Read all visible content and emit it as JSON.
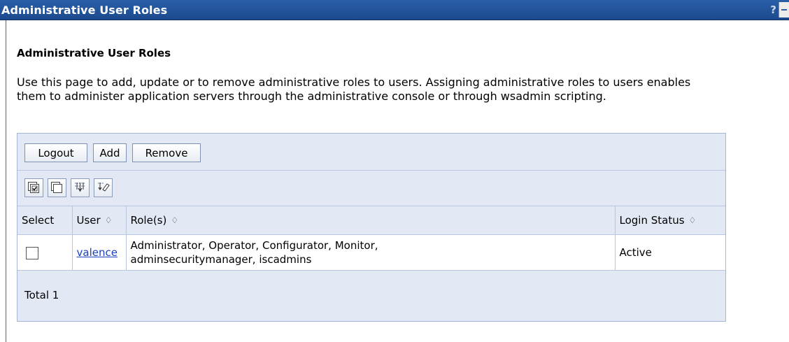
{
  "window": {
    "title": "Administrative User Roles",
    "help": "?"
  },
  "page": {
    "heading": "Administrative User Roles",
    "description": "Use this page to add, update or to remove administrative roles to users. Assigning administrative roles to users enables them to administer application servers through the administrative console or through wsadmin scripting."
  },
  "toolbar": {
    "logout_label": "Logout",
    "add_label": "Add",
    "remove_label": "Remove"
  },
  "icon_toolbar": [
    "select-all-icon",
    "deselect-all-icon",
    "show-filter-icon",
    "clear-filter-icon"
  ],
  "table": {
    "columns": {
      "select": "Select",
      "user": "User",
      "roles": "Role(s)",
      "login_status": "Login Status"
    },
    "sort_glyph": "♢",
    "rows": [
      {
        "selected": false,
        "user": "valence",
        "roles_line1": "Administrator, Operator, Configurator, Monitor,",
        "roles_line2": "adminsecuritymanager, iscadmins",
        "login_status": "Active"
      }
    ],
    "total": "Total 1"
  },
  "colors": {
    "title_bar": "#1c4a8e",
    "panel_bg": "#e3e9f4",
    "border": "#a3b6d6",
    "link": "#1a3fbf"
  }
}
